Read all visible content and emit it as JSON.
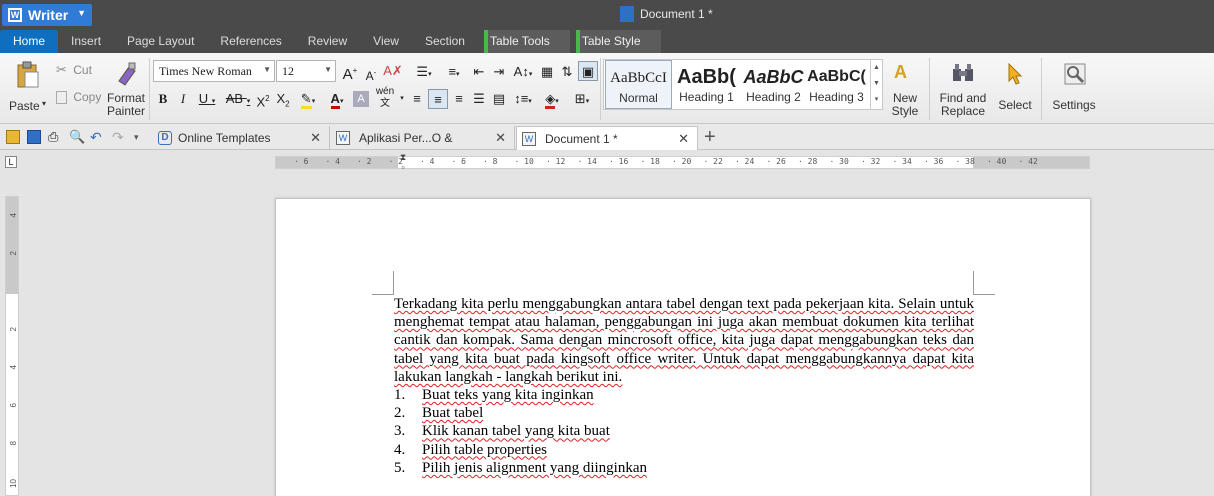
{
  "app": {
    "name": "Writer",
    "document_title": "Document 1 *"
  },
  "menu": {
    "tabs": [
      "Home",
      "Insert",
      "Page Layout",
      "References",
      "Review",
      "View",
      "Section"
    ],
    "context_tabs": [
      "Table Tools",
      "Table Style"
    ]
  },
  "ribbon": {
    "paste": "Paste",
    "cut": "Cut",
    "copy": "Copy",
    "format_painter_1": "Format",
    "format_painter_2": "Painter",
    "font_name": "Times New Roman",
    "font_size": "12",
    "styles": [
      {
        "preview": "AaBbCcI",
        "name": "Normal"
      },
      {
        "preview": "AaBb(",
        "name": "Heading 1"
      },
      {
        "preview": "AaBbC",
        "name": "Heading 2"
      },
      {
        "preview": "AaBbC(",
        "name": "Heading 3"
      }
    ],
    "new_style_1": "New",
    "new_style_2": "Style",
    "find_replace_1": "Find and",
    "find_replace_2": "Replace",
    "select": "Select",
    "settings": "Settings"
  },
  "doc_tabs": [
    {
      "label": "Online Templates"
    },
    {
      "label": "Aplikasi Per...O & MSO).docx"
    },
    {
      "label": "Document 1 *"
    }
  ],
  "ruler": {
    "h_labels": [
      "6",
      "4",
      "2",
      "2",
      "4",
      "6",
      "8",
      "10",
      "12",
      "14",
      "16",
      "18",
      "20",
      "22",
      "24",
      "26",
      "28",
      "30",
      "32",
      "34",
      "36",
      "38",
      "40",
      "42"
    ],
    "v_labels": [
      "4",
      "2",
      "",
      "2",
      "4",
      "6",
      "8",
      "10"
    ]
  },
  "document": {
    "paragraph": "Terkadang kita perlu menggabungkan antara tabel dengan text pada pekerjaan kita. Selain untuk menghemat tempat atau halaman, penggabungan ini juga akan membuat dokumen kita terlihat cantik dan kompak. Sama dengan mincrosoft office, kita juga dapat menggabungkan teks dan tabel yang kita buat pada kingsoft office writer. Untuk dapat menggabungkannya dapat kita lakukan langkah - langkah berikut ini.",
    "list": [
      {
        "num": "1.",
        "text": "Buat teks yang kita inginkan"
      },
      {
        "num": "2.",
        "text": "Buat tabel"
      },
      {
        "num": "3.",
        "text": "Klik kanan tabel yang kita buat"
      },
      {
        "num": "4.",
        "text": "Pilih table properties"
      },
      {
        "num": "5.",
        "text": "Pilih jenis alignment yang diinginkan"
      }
    ]
  },
  "colors": {
    "accent": "#0f6ebe",
    "titlebar": "#4a4a4a",
    "context_tab": "#49b84a",
    "spell": "#e02020"
  }
}
